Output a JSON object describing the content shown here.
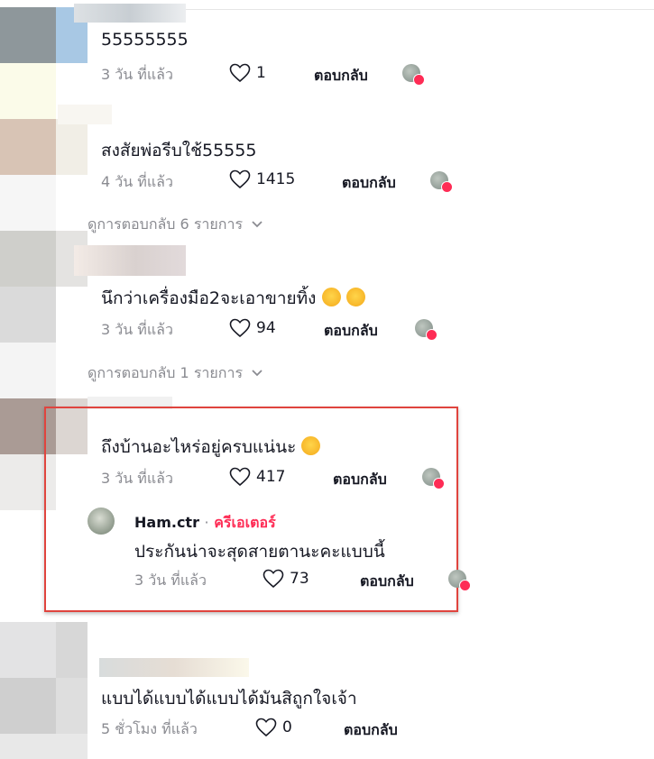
{
  "comments": [
    {
      "text": "55555555",
      "time": "3 วัน ที่แล้ว",
      "likes": "1",
      "reply": "ตอบกลับ"
    },
    {
      "text": "สงสัยพ่อรีบใช้55555",
      "time": "4 วัน ที่แล้ว",
      "likes": "1415",
      "reply": "ตอบกลับ",
      "view_replies": "ดูการตอบกลับ 6 รายการ"
    },
    {
      "text": "นึกว่าเครื่องมือ2จะเอาขายทิ้ง",
      "time": "3 วัน ที่แล้ว",
      "likes": "94",
      "reply": "ตอบกลับ",
      "view_replies": "ดูการตอบกลับ 1 รายการ"
    },
    {
      "text": "ถึงบ้านอะไหร่อยู่ครบแน่นะ",
      "time": "3 วัน ที่แล้ว",
      "likes": "417",
      "reply": "ตอบกลับ"
    },
    {
      "text": "แบบได้แบบได้แบบได้มันสิถูกใจเจ้า",
      "time": "5 ชั่วโมง ที่แล้ว",
      "likes": "0",
      "reply": "ตอบกลับ"
    }
  ],
  "creator_reply": {
    "username": "Ham.ctr",
    "separator": "·",
    "badge": "ครีเอเตอร์",
    "text": "ประกันน่าจะสุดสายตานะคะแบบนี้",
    "time": "3 วัน ที่แล้ว",
    "likes": "73",
    "reply": "ตอบกลับ"
  },
  "colors": {
    "accent": "#fe2c55",
    "highlight_border": "#e0443e",
    "muted": "#8a8b91"
  },
  "icons": {
    "like": "heart-outline-icon",
    "chevron": "chevron-down-icon",
    "liked_by_creator": "creator-avatar-heart-icon",
    "emoji": "laughing-emoji-icon"
  }
}
